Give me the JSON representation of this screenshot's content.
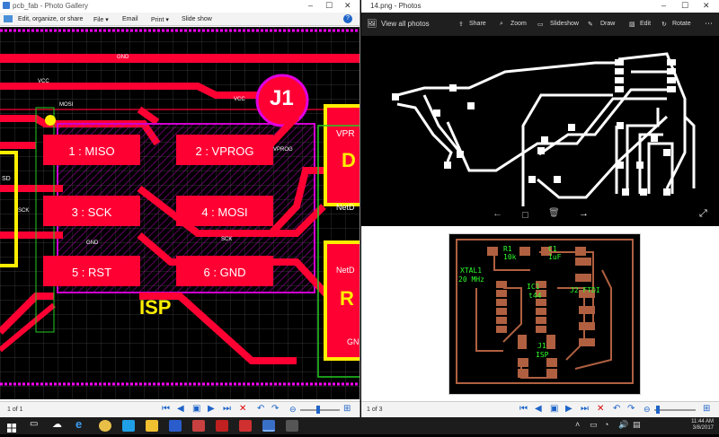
{
  "left_window": {
    "title": "pcb_fab - Photo Gallery",
    "menu": {
      "edit": "Edit, organize, or share",
      "file": "File ▾",
      "email": "Email",
      "print": "Print ▾",
      "slideshow": "Slide show"
    },
    "status": {
      "page": "1 of 1"
    },
    "pcb": {
      "connector": "J1",
      "label": "ISP",
      "pads": [
        "1 : MISO",
        "2 : VPROG",
        "3 : SCK",
        "4 : MOSI",
        "5 : RST",
        "6 : GND"
      ],
      "nets": {
        "gnd": "GND",
        "vcc": "VCC",
        "vcc2": "VCC",
        "mosi": "MOSI",
        "vprog": "VPROG",
        "sck": "SCK",
        "gnd2": "GND",
        "sck2": "SCK"
      },
      "edge_labels": {
        "d": "D",
        "r": "R",
        "vpr": "VPR",
        "netd1": "NetD",
        "netd2": "NetD",
        "gn": "GN",
        "sd": "SD"
      }
    }
  },
  "right_window": {
    "title": "14.png - Photos",
    "toolbar": {
      "view_all": "View all photos",
      "share": "Share",
      "zoom": "Zoom",
      "slideshow": "Slideshow",
      "draw": "Draw",
      "edit": "Edit",
      "rotate": "Rotate"
    },
    "status": {
      "page": "1 of 3"
    },
    "board": {
      "labels": [
        "R1",
        "10k",
        "C1",
        "1uF",
        "XTAL1",
        "20 MHz",
        "IC1",
        "t44",
        "J2 FTDI",
        "J1",
        "ISP"
      ]
    }
  },
  "taskbar": {
    "time": "11:44 AM",
    "date": "3/8/2017"
  },
  "colors": {
    "pcb_red": "#ff0033",
    "pcb_magenta": "#e000e0",
    "silk_yellow": "#ffee00",
    "copper": "#a0522d",
    "grid": "#3a3a3a"
  }
}
